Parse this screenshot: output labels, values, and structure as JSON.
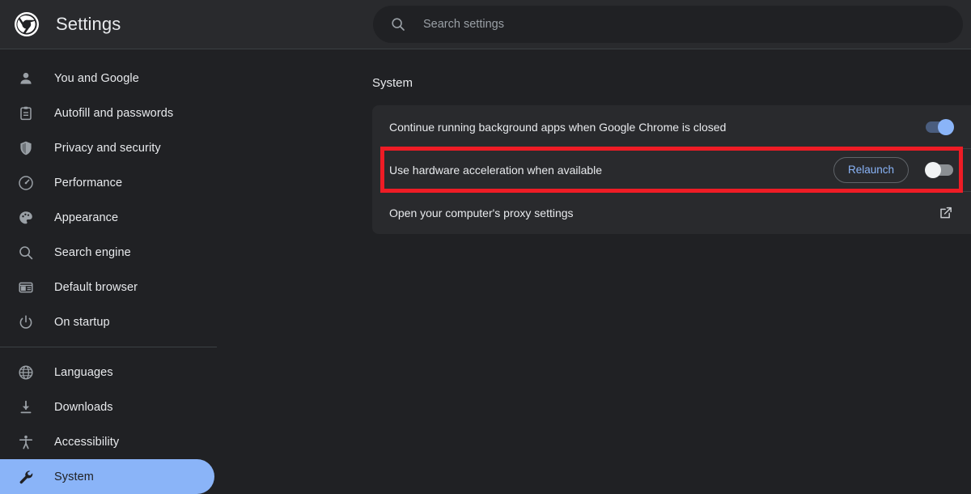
{
  "header": {
    "logo_icon": "chrome-logo-icon",
    "title": "Settings",
    "search": {
      "icon": "search-icon",
      "placeholder": "Search settings",
      "value": ""
    }
  },
  "sidebar": {
    "groups": [
      {
        "items": [
          {
            "label": "You and Google",
            "icon": "person-icon",
            "selected": false
          },
          {
            "label": "Autofill and passwords",
            "icon": "clipboard-icon",
            "selected": false
          },
          {
            "label": "Privacy and security",
            "icon": "shield-icon",
            "selected": false
          },
          {
            "label": "Performance",
            "icon": "speedometer-icon",
            "selected": false
          },
          {
            "label": "Appearance",
            "icon": "palette-icon",
            "selected": false
          },
          {
            "label": "Search engine",
            "icon": "magnifier-icon",
            "selected": false
          },
          {
            "label": "Default browser",
            "icon": "browser-window-icon",
            "selected": false
          },
          {
            "label": "On startup",
            "icon": "power-icon",
            "selected": false
          }
        ]
      },
      {
        "items": [
          {
            "label": "Languages",
            "icon": "globe-icon",
            "selected": false
          },
          {
            "label": "Downloads",
            "icon": "download-icon",
            "selected": false
          },
          {
            "label": "Accessibility",
            "icon": "accessibility-icon",
            "selected": false
          },
          {
            "label": "System",
            "icon": "wrench-icon",
            "selected": true
          }
        ]
      }
    ]
  },
  "main": {
    "section_title": "System",
    "rows": [
      {
        "label": "Continue running background apps when Google Chrome is closed",
        "control": "toggle",
        "toggle_state": "on"
      },
      {
        "label": "Use hardware acceleration when available",
        "control": "relaunch-and-toggle",
        "button_label": "Relaunch",
        "toggle_state": "off",
        "highlighted": true
      },
      {
        "label": "Open your computer's proxy settings",
        "control": "external-link",
        "icon": "external-link-icon"
      }
    ]
  },
  "annotation": {
    "color": "#ee1c25",
    "target": "Use hardware acceleration when available"
  },
  "colors": {
    "page_background": "#202124",
    "surface": "#292a2d",
    "accent": "#8ab4f8",
    "text_primary": "#e8eaed",
    "text_secondary": "#9aa0a6",
    "divider": "#3c4043",
    "annotation": "#ee1c25"
  }
}
